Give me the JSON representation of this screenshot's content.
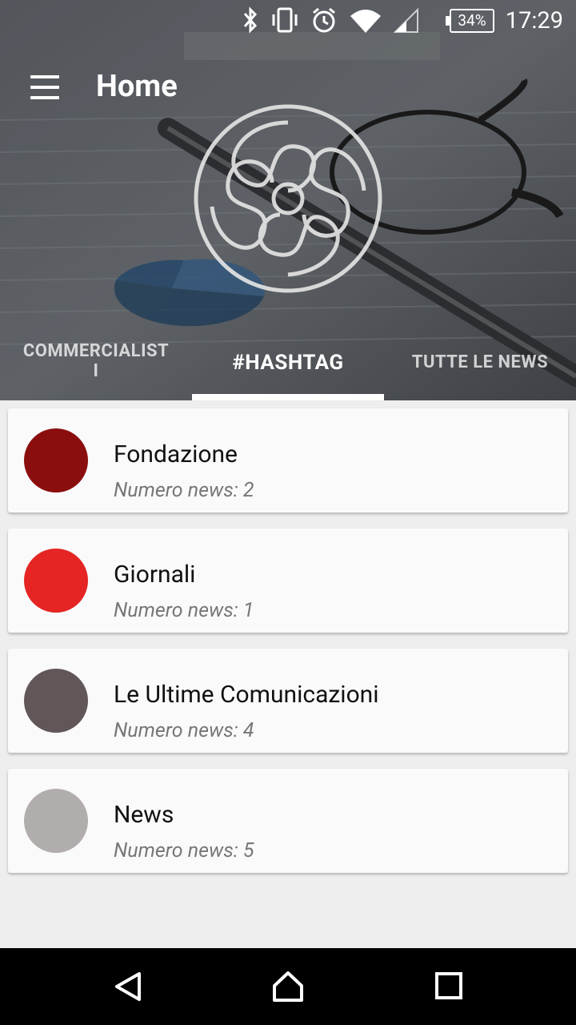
{
  "status": {
    "battery": "34%",
    "time": "17:29"
  },
  "toolbar": {
    "title": "Home"
  },
  "tabs": [
    {
      "label": "COMMERCIALIST",
      "label2": "I"
    },
    {
      "label": "#HASHTAG"
    },
    {
      "label": "TUTTE LE NEWS"
    }
  ],
  "cards": [
    {
      "title": "Fondazione",
      "subtitle": "Numero news: 2",
      "color": "#8b0e0e"
    },
    {
      "title": "Giornali",
      "subtitle": "Numero news: 1",
      "color": "#e52424"
    },
    {
      "title": "Le Ultime Comunicazioni",
      "subtitle": "Numero news: 4",
      "color": "#625758"
    },
    {
      "title": "News",
      "subtitle": "Numero news: 5",
      "color": "#b2adad"
    }
  ]
}
